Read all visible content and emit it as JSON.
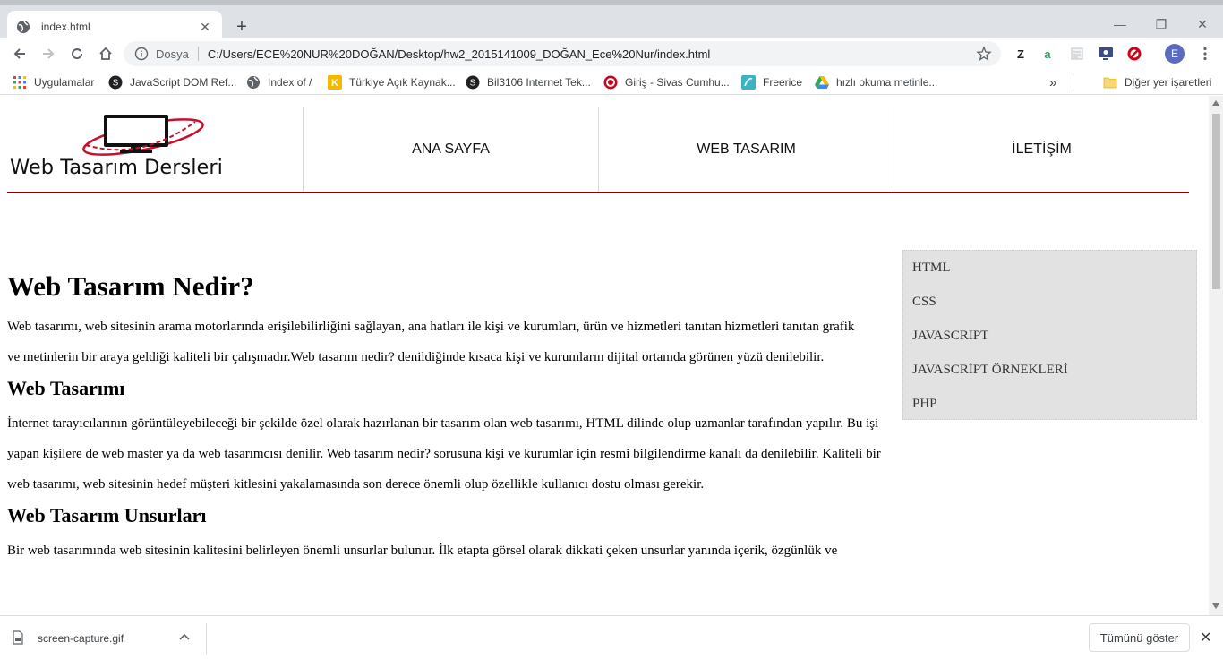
{
  "browser": {
    "tab_title": "index.html",
    "tab_close": "✕",
    "new_tab": "+",
    "window_minimize": "—",
    "window_restore": "❐",
    "window_close": "✕",
    "scheme_label": "Dosya",
    "url": "C:/Users/ECE%20NUR%20DOĞAN/Desktop/hw2_2015141009_DOĞAN_Ece%20Nur/index.html",
    "extensions": {
      "z_label": "Z",
      "a_label": "a",
      "profile_initial": "E"
    },
    "bookmarks": [
      {
        "label": "Uygulamalar",
        "icon": "apps-grid-icon"
      },
      {
        "label": "JavaScript DOM Ref...",
        "icon": "site-icon"
      },
      {
        "label": "Index of /",
        "icon": "globe-icon"
      },
      {
        "label": "Türkiye Açık Kaynak...",
        "icon": "k-icon"
      },
      {
        "label": "Bil3106 Internet Tek...",
        "icon": "site-icon"
      },
      {
        "label": "Giriş - Sivas Cumhu...",
        "icon": "target-icon"
      },
      {
        "label": "Freerice",
        "icon": "freerice-icon"
      },
      {
        "label": "hızlı okuma metinle...",
        "icon": "drive-icon"
      }
    ],
    "bookmarks_more": "»",
    "other_bookmarks": "Diğer yer işaretleri"
  },
  "page": {
    "logo_text": "Web Tasarım Dersleri",
    "nav": [
      "ANA SAYFA",
      "WEB TASARIM",
      "İLETİŞİM"
    ],
    "heading_main": "Web Tasarım Nedir?",
    "para1": "Web tasarımı, web sitesinin arama motorlarında erişilebilirliğini sağlayan, ana hatları ile kişi ve kurumları, ürün ve hizmetleri tanıtan hizmetleri tanıtan grafik ve metinlerin bir araya geldiği kaliteli bir çalışmadır.Web tasarım nedir? denildiğinde kısaca kişi ve kurumların dijital ortamda görünen yüzü denilebilir.",
    "heading2": "Web Tasarımı",
    "para2": "İnternet tarayıcılarının görüntüleyebileceği bir şekilde özel olarak hazırlanan bir tasarım olan web tasarımı, HTML dilinde olup uzmanlar tarafından yapılır. Bu işi yapan kişilere de web master ya da web tasarımcısı denilir. Web tasarım nedir? sorusuna kişi ve kurumlar için resmi bilgilendirme kanalı da denilebilir. Kaliteli bir web tasarımı, web sitesinin hedef müşteri kitlesini yakalamasında son derece önemli olup özellikle kullanıcı dostu olması gerekir.",
    "heading3": "Web Tasarım Unsurları",
    "para3": "Bir web tasarımında web sitesinin kalitesini belirleyen önemli unsurlar bulunur. İlk etapta görsel olarak dikkati çeken unsurlar yanında içerik, özgünlük ve",
    "sidebar": [
      "HTML",
      "CSS",
      "JAVASCRIPT",
      "JAVASCRİPT ÖRNEKLERİ",
      "PHP"
    ]
  },
  "downloads": {
    "file_name": "screen-capture.gif",
    "show_all": "Tümünü göster",
    "close": "✕"
  },
  "colors": {
    "accent_line": "#8b0000",
    "tabstrip": "#dee1e6",
    "sidebar_bg": "#e2e2e2"
  }
}
